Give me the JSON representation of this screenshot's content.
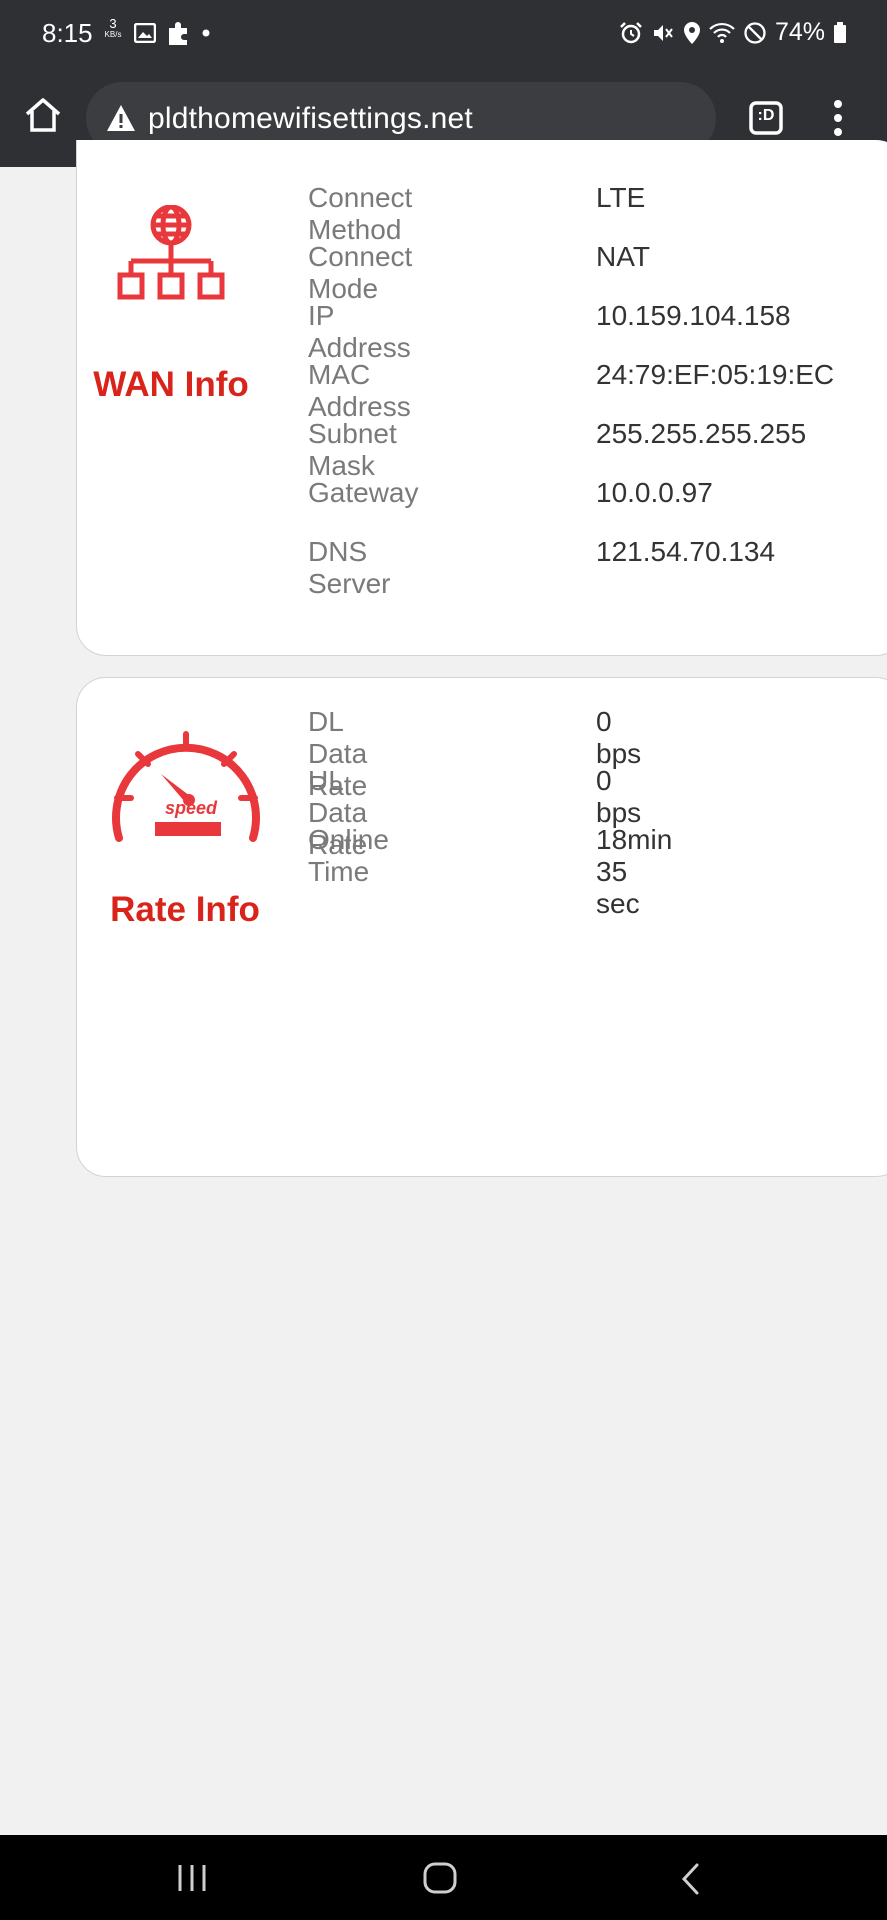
{
  "status_bar": {
    "time": "8:15",
    "net_speed_value": "3",
    "net_speed_unit": "KB/s",
    "battery": "74%"
  },
  "browser": {
    "url": "pldthomewifisettings.net",
    "tab_count": ":D"
  },
  "wan": {
    "title": "WAN Info",
    "rows": [
      {
        "label": "Connect Method",
        "value": "LTE"
      },
      {
        "label": "Connect Mode",
        "value": "NAT"
      },
      {
        "label": "IP Address",
        "value": "10.159.104.158"
      },
      {
        "label": "MAC Address",
        "value": "24:79:EF:05:19:EC"
      },
      {
        "label": "Subnet Mask",
        "value": "255.255.255.255"
      },
      {
        "label": "Gateway",
        "value": "10.0.0.97"
      },
      {
        "label": "DNS Server",
        "value": "121.54.70.134"
      }
    ]
  },
  "rate": {
    "title": "Rate Info",
    "icon_text": "speed",
    "rows": [
      {
        "label": "DL Data Rate",
        "value": "0 bps"
      },
      {
        "label": "UL Data Rate",
        "value": "0 bps"
      },
      {
        "label": "Online Time",
        "value": "18min 35 sec"
      }
    ]
  },
  "colors": {
    "accent": "#d9241b",
    "bar": "#2f3033"
  },
  "icons": [
    "home-icon",
    "warning-icon",
    "tab-switcher-icon",
    "more-vert-icon",
    "network-topology-icon",
    "speedometer-icon",
    "recents-icon",
    "home-nav-icon",
    "back-icon"
  ]
}
